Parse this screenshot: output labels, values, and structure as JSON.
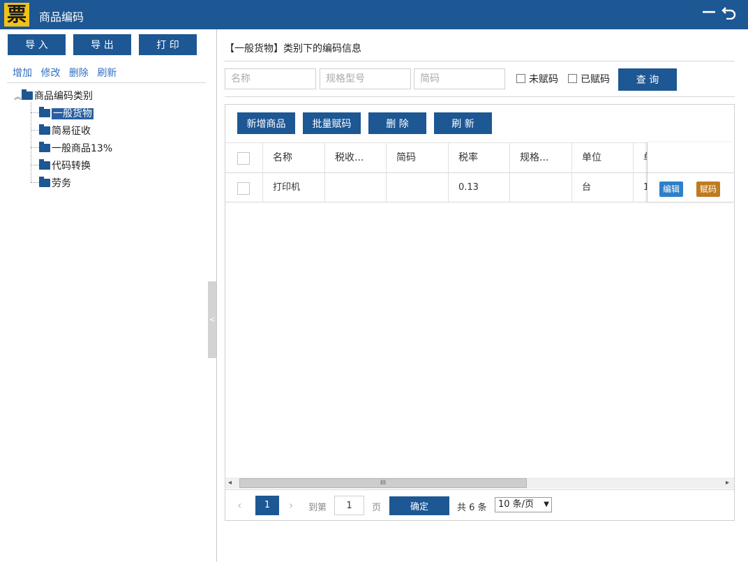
{
  "titlebar": {
    "logo_char": "票",
    "title": "商品编码",
    "minimize_icon": "minimize-icon",
    "back_icon": "back-icon"
  },
  "left": {
    "buttons": {
      "import": "导 入",
      "export": "导 出",
      "print": "打 印"
    },
    "links": {
      "add": "增加",
      "edit": "修改",
      "delete": "删除",
      "refresh": "刷新"
    },
    "tree": {
      "root": "商品编码类别",
      "children": [
        "一般货物",
        "简易征收",
        "一般商品13%",
        "代码转换",
        "劳务"
      ],
      "selected": "一般货物"
    },
    "collapse_glyph": "<"
  },
  "main": {
    "heading": "【一般货物】类别下的编码信息",
    "filters": {
      "name_placeholder": "名称",
      "spec_placeholder": "规格型号",
      "code_placeholder": "简码",
      "unassigned_label": "未赋码",
      "assigned_label": "已赋码",
      "query_button": "查 询"
    },
    "toolbar": {
      "add_goods": "新增商品",
      "batch_assign": "批量赋码",
      "delete": "删 除",
      "refresh": "刷 新"
    },
    "table": {
      "columns": [
        "名称",
        "税收...",
        "简码",
        "税率",
        "规格...",
        "单位",
        "单"
      ],
      "rows": [
        {
          "name": "打印机",
          "tax_class": "",
          "short_code": "",
          "rate": "0.13",
          "spec": "",
          "unit": "台",
          "price": "1"
        }
      ],
      "row_actions": {
        "edit": "编辑",
        "assign": "赋码"
      }
    },
    "scrollbar_grip": "III",
    "pager": {
      "current_page": "1",
      "goto_label": "到第",
      "goto_value": "1",
      "page_suffix": "页",
      "confirm": "确定",
      "total": "共 6 条",
      "page_size": "10 条/页",
      "page_size_options": [
        "10 条/页"
      ]
    }
  },
  "colors": {
    "primary": "#1d5794",
    "link": "#2f6fbf",
    "edit_tag": "#2f7fc9",
    "assign_tag": "#c07a22",
    "logo": "#f2c11a"
  }
}
